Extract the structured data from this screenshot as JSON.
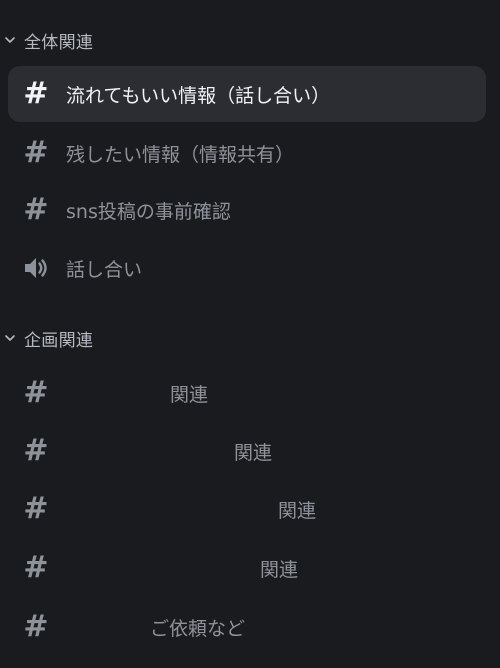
{
  "categories": [
    {
      "label": "全体関連"
    },
    {
      "label": "企画関連"
    }
  ],
  "channels_general": [
    {
      "icon": "hash-icon",
      "label": "流れてもいい情報（話し合い）",
      "selected": true
    },
    {
      "icon": "hash-icon",
      "label": "残したい情報（情報共有）",
      "selected": false
    },
    {
      "icon": "hash-icon",
      "label": "sns投稿の事前確認",
      "selected": false
    },
    {
      "icon": "speaker-icon",
      "label": "話し合い",
      "selected": false
    }
  ],
  "channels_planning": [
    {
      "icon": "hash-icon",
      "label": "関連",
      "selected": false
    },
    {
      "icon": "hash-icon",
      "label": "関連",
      "selected": false
    },
    {
      "icon": "hash-icon",
      "label": "関連",
      "selected": false
    },
    {
      "icon": "hash-icon",
      "label": "関連",
      "selected": false
    },
    {
      "icon": "hash-icon",
      "label": "ご依頼など",
      "selected": false
    }
  ],
  "colors": {
    "background": "#1a1b1f",
    "selected_background": "#2b2d33",
    "selected_text": "#f2f3f5",
    "muted_text": "#8e9299",
    "category_text": "#b5bac1"
  }
}
